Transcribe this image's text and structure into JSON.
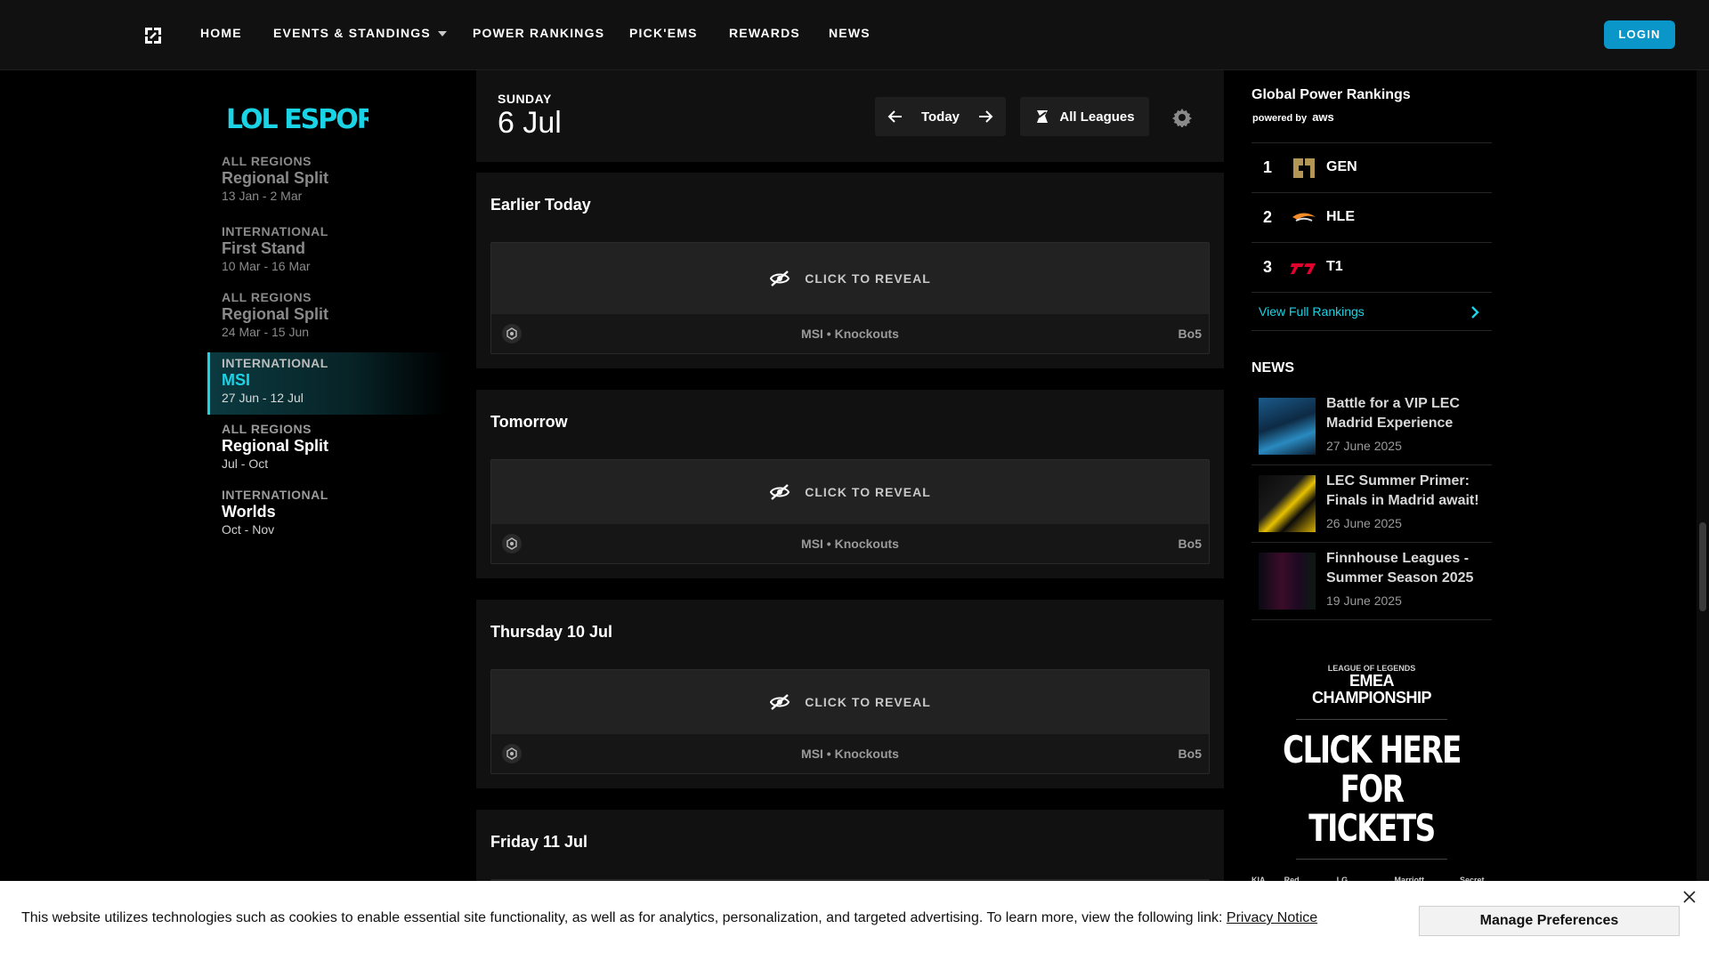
{
  "nav": {
    "items": [
      {
        "label": "HOME"
      },
      {
        "label": "EVENTS & STANDINGS"
      },
      {
        "label": "POWER RANKINGS"
      },
      {
        "label": "PICK'EMS"
      },
      {
        "label": "REWARDS"
      },
      {
        "label": "NEWS"
      }
    ],
    "login_label": "LOGIN"
  },
  "sidebar": {
    "brand": "LOL ESPORTS",
    "splits": [
      {
        "region": "ALL REGIONS",
        "name": "Regional Split",
        "dates": "13 Jan - 2 Mar",
        "state": "past"
      },
      {
        "region": "INTERNATIONAL",
        "name": "First Stand",
        "dates": "10 Mar - 16 Mar",
        "state": "past"
      },
      {
        "region": "ALL REGIONS",
        "name": "Regional Split",
        "dates": "24 Mar - 15 Jun",
        "state": "past"
      },
      {
        "region": "INTERNATIONAL",
        "name": "MSI",
        "dates": "27 Jun - 12 Jul",
        "state": "active"
      },
      {
        "region": "ALL REGIONS",
        "name": "Regional Split",
        "dates": "Jul - Oct",
        "state": "future"
      },
      {
        "region": "INTERNATIONAL",
        "name": "Worlds",
        "dates": "Oct - Nov",
        "state": "future"
      }
    ]
  },
  "schedule": {
    "day_label": "SUNDAY",
    "date_label": "6 Jul",
    "today_label": "Today",
    "leagues_label": "All Leagues",
    "blocks": [
      {
        "heading": "Earlier Today",
        "reveal": "CLICK TO REVEAL",
        "match": "MSI • Knockouts",
        "format": "Bo5"
      },
      {
        "heading": "Tomorrow",
        "reveal": "CLICK TO REVEAL",
        "match": "MSI • Knockouts",
        "format": "Bo5"
      },
      {
        "heading": "Thursday 10 Jul",
        "reveal": "CLICK TO REVEAL",
        "match": "MSI • Knockouts",
        "format": "Bo5"
      },
      {
        "heading": "Friday 11 Jul"
      }
    ]
  },
  "rankings": {
    "title": "Global Power Rankings",
    "powered_by": "powered by",
    "powered_brand": "aws",
    "teams": [
      {
        "rank": "1",
        "team": "GEN",
        "color": "#b39656"
      },
      {
        "rank": "2",
        "team": "HLE",
        "color": "#f28c28"
      },
      {
        "rank": "3",
        "team": "T1",
        "color": "#e2012d"
      }
    ],
    "view_full": "View Full Rankings"
  },
  "news": {
    "heading": "NEWS",
    "items": [
      {
        "headline": "Battle for a VIP LEC Madrid Experience",
        "date": "27 June 2025"
      },
      {
        "headline": "LEC Summer Primer: Finals in Madrid await!",
        "date": "26 June 2025"
      },
      {
        "headline": "Finnhouse Leagues - Summer Season 2025",
        "date": "19 June 2025"
      }
    ]
  },
  "ad": {
    "emea_line1": "LEAGUE OF LEGENDS",
    "emea_line2": "EMEA",
    "emea_line3": "CHAMPIONSHIP",
    "cta_line1": "CLICK HERE",
    "cta_line2": "FOR TICKETS",
    "sponsors": [
      "KIA",
      "Red Bull",
      "LG UltraGear",
      "Marriott BONVOY",
      "Secret Lab"
    ]
  },
  "cookie": {
    "text": "This website utilizes technologies such as cookies to enable essential site functionality, as well as for analytics, personalization, and targeted advertising. To learn more, view the following link:",
    "link": "Privacy Notice",
    "manage_label": "Manage Preferences"
  },
  "colors": {
    "accent": "#1ad4e6",
    "login": "#0a96c8",
    "background": "#000000",
    "panel": "#111111"
  }
}
